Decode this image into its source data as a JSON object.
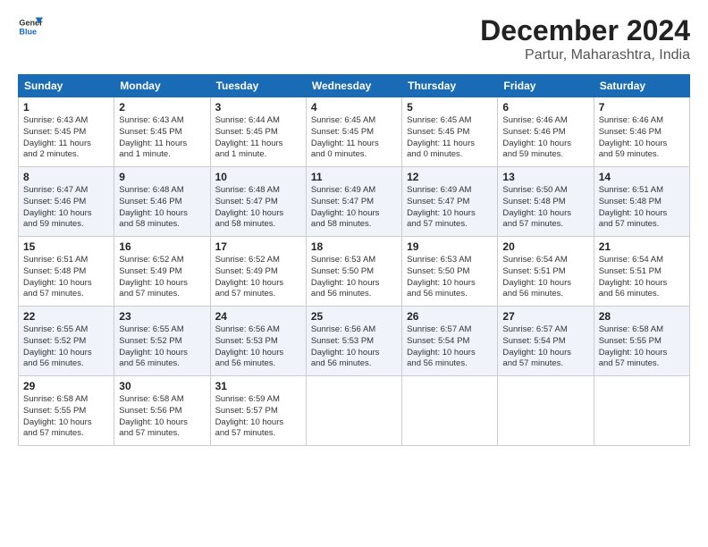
{
  "logo": {
    "line1": "General",
    "line2": "Blue"
  },
  "title": "December 2024",
  "subtitle": "Partur, Maharashtra, India",
  "days_of_week": [
    "Sunday",
    "Monday",
    "Tuesday",
    "Wednesday",
    "Thursday",
    "Friday",
    "Saturday"
  ],
  "weeks": [
    [
      {
        "day": "1",
        "info": "Sunrise: 6:43 AM\nSunset: 5:45 PM\nDaylight: 11 hours\nand 2 minutes."
      },
      {
        "day": "2",
        "info": "Sunrise: 6:43 AM\nSunset: 5:45 PM\nDaylight: 11 hours\nand 1 minute."
      },
      {
        "day": "3",
        "info": "Sunrise: 6:44 AM\nSunset: 5:45 PM\nDaylight: 11 hours\nand 1 minute."
      },
      {
        "day": "4",
        "info": "Sunrise: 6:45 AM\nSunset: 5:45 PM\nDaylight: 11 hours\nand 0 minutes."
      },
      {
        "day": "5",
        "info": "Sunrise: 6:45 AM\nSunset: 5:45 PM\nDaylight: 11 hours\nand 0 minutes."
      },
      {
        "day": "6",
        "info": "Sunrise: 6:46 AM\nSunset: 5:46 PM\nDaylight: 10 hours\nand 59 minutes."
      },
      {
        "day": "7",
        "info": "Sunrise: 6:46 AM\nSunset: 5:46 PM\nDaylight: 10 hours\nand 59 minutes."
      }
    ],
    [
      {
        "day": "8",
        "info": "Sunrise: 6:47 AM\nSunset: 5:46 PM\nDaylight: 10 hours\nand 59 minutes."
      },
      {
        "day": "9",
        "info": "Sunrise: 6:48 AM\nSunset: 5:46 PM\nDaylight: 10 hours\nand 58 minutes."
      },
      {
        "day": "10",
        "info": "Sunrise: 6:48 AM\nSunset: 5:47 PM\nDaylight: 10 hours\nand 58 minutes."
      },
      {
        "day": "11",
        "info": "Sunrise: 6:49 AM\nSunset: 5:47 PM\nDaylight: 10 hours\nand 58 minutes."
      },
      {
        "day": "12",
        "info": "Sunrise: 6:49 AM\nSunset: 5:47 PM\nDaylight: 10 hours\nand 57 minutes."
      },
      {
        "day": "13",
        "info": "Sunrise: 6:50 AM\nSunset: 5:48 PM\nDaylight: 10 hours\nand 57 minutes."
      },
      {
        "day": "14",
        "info": "Sunrise: 6:51 AM\nSunset: 5:48 PM\nDaylight: 10 hours\nand 57 minutes."
      }
    ],
    [
      {
        "day": "15",
        "info": "Sunrise: 6:51 AM\nSunset: 5:48 PM\nDaylight: 10 hours\nand 57 minutes."
      },
      {
        "day": "16",
        "info": "Sunrise: 6:52 AM\nSunset: 5:49 PM\nDaylight: 10 hours\nand 57 minutes."
      },
      {
        "day": "17",
        "info": "Sunrise: 6:52 AM\nSunset: 5:49 PM\nDaylight: 10 hours\nand 57 minutes."
      },
      {
        "day": "18",
        "info": "Sunrise: 6:53 AM\nSunset: 5:50 PM\nDaylight: 10 hours\nand 56 minutes."
      },
      {
        "day": "19",
        "info": "Sunrise: 6:53 AM\nSunset: 5:50 PM\nDaylight: 10 hours\nand 56 minutes."
      },
      {
        "day": "20",
        "info": "Sunrise: 6:54 AM\nSunset: 5:51 PM\nDaylight: 10 hours\nand 56 minutes."
      },
      {
        "day": "21",
        "info": "Sunrise: 6:54 AM\nSunset: 5:51 PM\nDaylight: 10 hours\nand 56 minutes."
      }
    ],
    [
      {
        "day": "22",
        "info": "Sunrise: 6:55 AM\nSunset: 5:52 PM\nDaylight: 10 hours\nand 56 minutes."
      },
      {
        "day": "23",
        "info": "Sunrise: 6:55 AM\nSunset: 5:52 PM\nDaylight: 10 hours\nand 56 minutes."
      },
      {
        "day": "24",
        "info": "Sunrise: 6:56 AM\nSunset: 5:53 PM\nDaylight: 10 hours\nand 56 minutes."
      },
      {
        "day": "25",
        "info": "Sunrise: 6:56 AM\nSunset: 5:53 PM\nDaylight: 10 hours\nand 56 minutes."
      },
      {
        "day": "26",
        "info": "Sunrise: 6:57 AM\nSunset: 5:54 PM\nDaylight: 10 hours\nand 56 minutes."
      },
      {
        "day": "27",
        "info": "Sunrise: 6:57 AM\nSunset: 5:54 PM\nDaylight: 10 hours\nand 57 minutes."
      },
      {
        "day": "28",
        "info": "Sunrise: 6:58 AM\nSunset: 5:55 PM\nDaylight: 10 hours\nand 57 minutes."
      }
    ],
    [
      {
        "day": "29",
        "info": "Sunrise: 6:58 AM\nSunset: 5:55 PM\nDaylight: 10 hours\nand 57 minutes."
      },
      {
        "day": "30",
        "info": "Sunrise: 6:58 AM\nSunset: 5:56 PM\nDaylight: 10 hours\nand 57 minutes."
      },
      {
        "day": "31",
        "info": "Sunrise: 6:59 AM\nSunset: 5:57 PM\nDaylight: 10 hours\nand 57 minutes."
      },
      {
        "day": "",
        "info": ""
      },
      {
        "day": "",
        "info": ""
      },
      {
        "day": "",
        "info": ""
      },
      {
        "day": "",
        "info": ""
      }
    ]
  ]
}
